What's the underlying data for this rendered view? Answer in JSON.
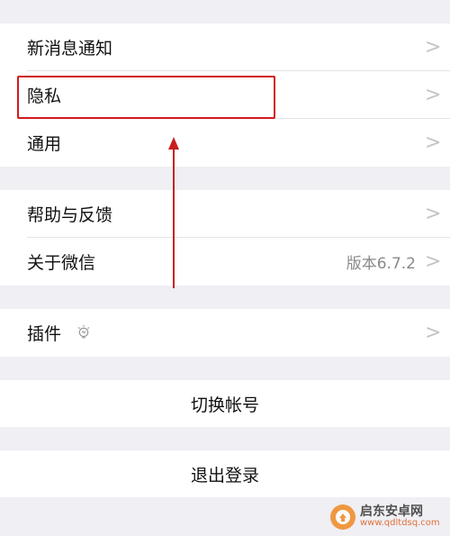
{
  "settings": {
    "group1": [
      {
        "label": "新消息通知"
      },
      {
        "label": "隐私"
      },
      {
        "label": "通用"
      }
    ],
    "group2": [
      {
        "label": "帮助与反馈"
      },
      {
        "label": "关于微信",
        "value": "版本6.7.2"
      }
    ],
    "group3": [
      {
        "label": "插件"
      }
    ],
    "switch_account": "切换帐号",
    "logout": "退出登录"
  },
  "chevron_glyph": ">",
  "annotation": {
    "highlight_color": "#d21b1b"
  },
  "watermark": {
    "title": "启东安卓网",
    "url": "www.qdltdsq.com"
  }
}
